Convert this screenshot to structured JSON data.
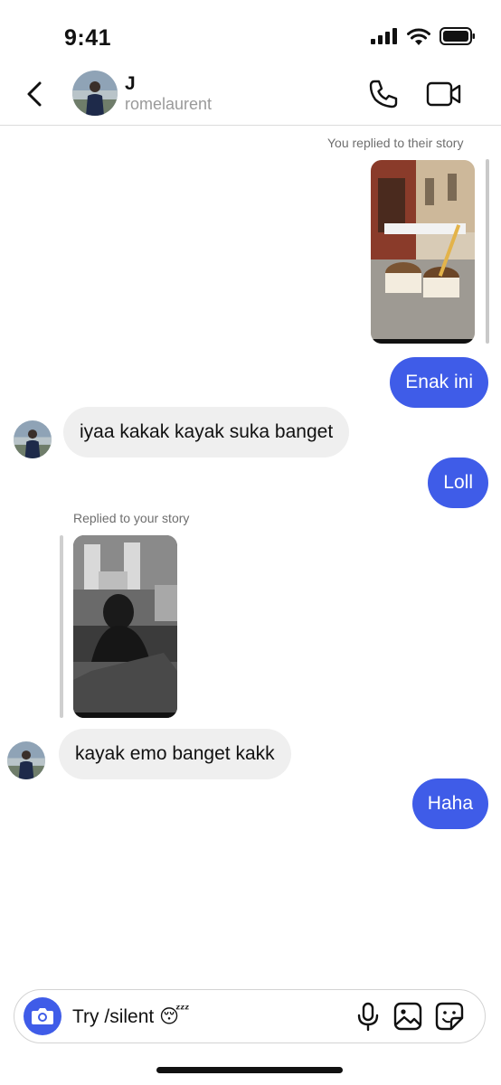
{
  "status_bar": {
    "time": "9:41"
  },
  "header": {
    "name": "J",
    "username": "romelaurent"
  },
  "messages": {
    "caption_replied_their_story": "You replied to their story",
    "msg1": "Enak ini",
    "msg2": "iyaa kakak kayak suka banget",
    "msg3": "Loll",
    "caption_replied_your_story": "Replied to your story",
    "msg4": "kayak emo banget kakk",
    "msg5": "Haha"
  },
  "composer": {
    "placeholder": "Try /silent 😴"
  },
  "colors": {
    "accent": "#3f5ce8",
    "incoming_bubble": "#efefef",
    "caption": "#6e6e6e"
  },
  "icons": [
    "back-icon",
    "phone-icon",
    "video-camera-icon",
    "camera-icon",
    "microphone-icon",
    "image-icon",
    "sticker-icon"
  ]
}
